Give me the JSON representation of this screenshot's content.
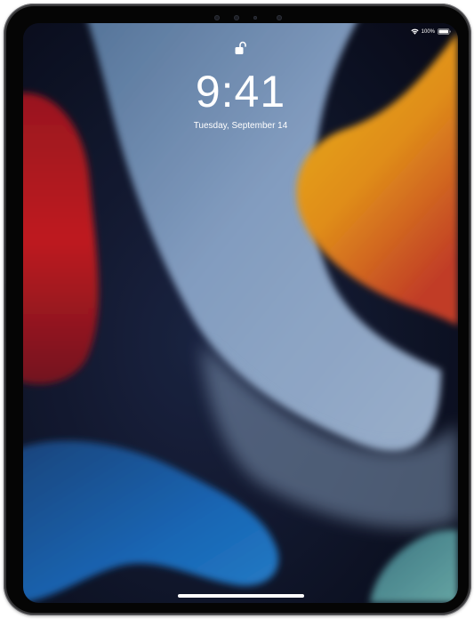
{
  "device": "iPad",
  "lock_screen": {
    "lock_state": "unlocked",
    "lock_icon": "lock-open-icon",
    "time": "9:41",
    "date": "Tuesday, September 14"
  },
  "status_bar": {
    "wifi_icon": "wifi-icon",
    "battery_text": "100%",
    "battery_level": 1.0,
    "battery_icon": "battery-full-icon"
  },
  "colors": {
    "bezel": "#050505",
    "frame": "#2f2f31",
    "wallpaper_blue": "#7d9cc0",
    "wallpaper_orange": "#f4a51c",
    "wallpaper_red": "#c11a1f",
    "wallpaper_navy": "#141a33",
    "wallpaper_teal": "#5fa4a8",
    "text": "#ffffff"
  }
}
